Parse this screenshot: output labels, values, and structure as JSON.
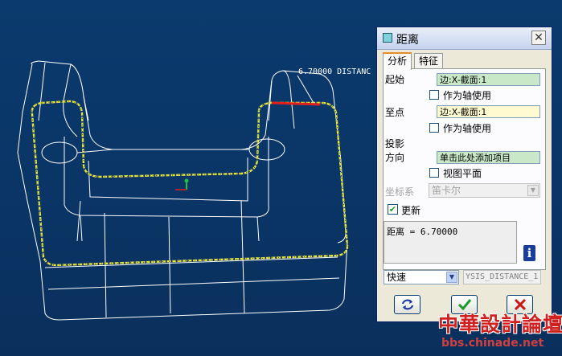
{
  "viewport": {
    "dimension_label": "6.70000  DISTANC",
    "colors": {
      "background": "#0b3a6e",
      "edges": "#ffffff",
      "highlight": "#e8e840",
      "selected_edge": "#e02020"
    }
  },
  "dialog": {
    "title": "距离",
    "close_label": "✕",
    "tabs": [
      {
        "label": "分析"
      },
      {
        "label": "特征"
      }
    ],
    "from": {
      "label": "起始",
      "value": "边:X-截面:1",
      "axis_checkbox_label": "作为轴使用"
    },
    "to": {
      "label": "至点",
      "value": "边:X-截面:1",
      "axis_checkbox_label": "作为轴使用"
    },
    "projection": {
      "label": "投影",
      "direction_label": "方向",
      "direction_value": "单击此处添加项目",
      "view_plane_label": "视图平面"
    },
    "coord_system": {
      "label": "坐标系",
      "value": "笛卡尔"
    },
    "update": {
      "label": "更新",
      "checked": true
    },
    "result": "距离 = 6.70000",
    "speed": {
      "value": "快速"
    },
    "feature_name": "YSIS_DISTANCE_1",
    "buttons": {
      "repeat_icon": "repeat-icon",
      "ok_icon": "checkmark-icon",
      "cancel_icon": "cross-icon"
    }
  },
  "watermark": {
    "title": "中華設計論壇",
    "url": "bbs.chinade.net"
  }
}
